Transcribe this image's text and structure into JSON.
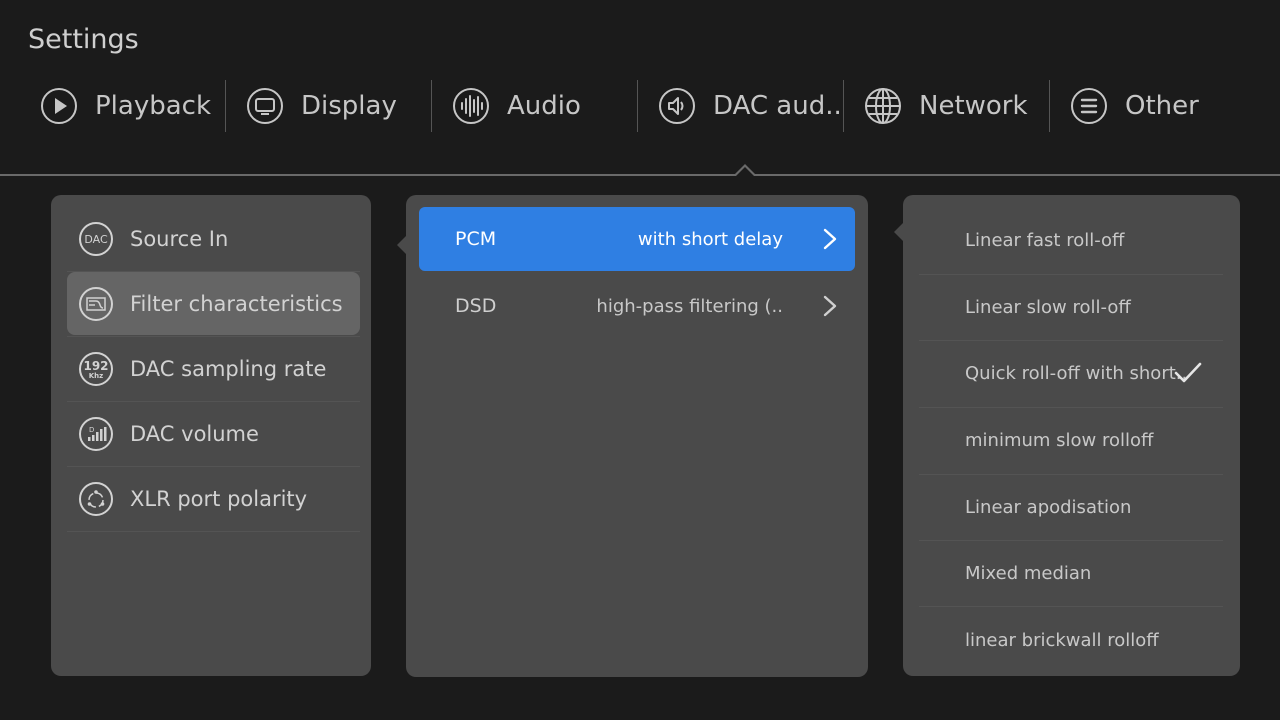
{
  "page": {
    "title": "Settings"
  },
  "tabs": [
    {
      "label": "Playback",
      "icon": "play-icon"
    },
    {
      "label": "Display",
      "icon": "monitor-icon"
    },
    {
      "label": "Audio",
      "icon": "audio-wave-icon"
    },
    {
      "label": "DAC aud..",
      "icon": "speaker-icon"
    },
    {
      "label": "Network",
      "icon": "globe-icon"
    },
    {
      "label": "Other",
      "icon": "menu-icon"
    }
  ],
  "active_tab": "DAC aud..",
  "sidebar": {
    "items": [
      {
        "label": "Source In",
        "icon": "dac-icon",
        "icon_text": "DAC"
      },
      {
        "label": "Filter characteristics",
        "icon": "filter-icon"
      },
      {
        "label": "DAC sampling rate",
        "icon": "sample-rate-icon",
        "icon_text_top": "192",
        "icon_text_bottom": "Khz"
      },
      {
        "label": "DAC volume",
        "icon": "volume-icon"
      },
      {
        "label": "XLR port polarity",
        "icon": "xlr-icon"
      }
    ],
    "active_index": 1
  },
  "filters": {
    "rows": [
      {
        "name": "PCM",
        "value": "with short delay"
      },
      {
        "name": "DSD",
        "value": "high-pass filtering (.."
      }
    ],
    "active_index": 0
  },
  "options": {
    "items": [
      {
        "label": "Linear fast roll-off"
      },
      {
        "label": "Linear slow roll-off"
      },
      {
        "label": "Quick roll-off with short.."
      },
      {
        "label": "minimum slow rolloff"
      },
      {
        "label": "Linear apodisation"
      },
      {
        "label": "Mixed median"
      },
      {
        "label": "linear brickwall rolloff"
      }
    ],
    "selected_index": 2
  },
  "colors": {
    "background": "#1b1b1b",
    "panel": "#4a4a4a",
    "accent": "#2f7fe3",
    "active_item": "#656565"
  }
}
